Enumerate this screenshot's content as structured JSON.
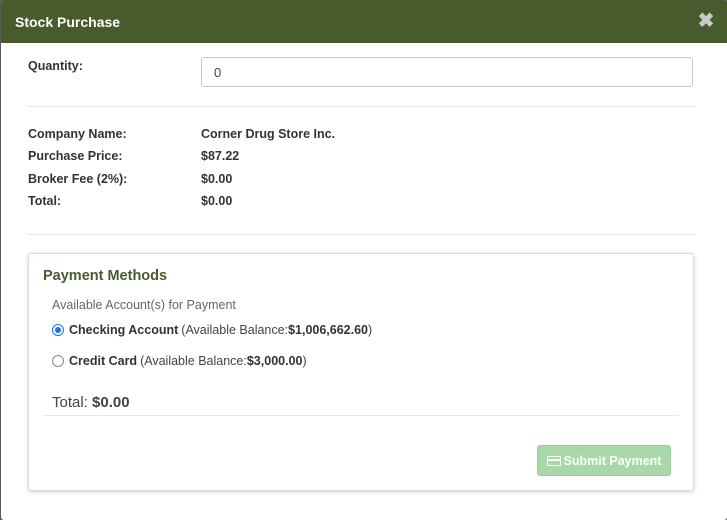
{
  "modal": {
    "title": "Stock Purchase",
    "close_icon": "close-icon"
  },
  "quantity": {
    "label": "Quantity:",
    "value": "0"
  },
  "details": [
    {
      "label": "Company Name:",
      "value": "Corner Drug Store Inc."
    },
    {
      "label": "Purchase Price:",
      "value": "$87.22"
    },
    {
      "label": "Broker Fee (2%):",
      "value": "$0.00"
    },
    {
      "label": "Total:",
      "value": "$0.00"
    }
  ],
  "payment": {
    "title": "Payment Methods",
    "available_label": "Available Account(s) for Payment",
    "accounts": [
      {
        "name": "Checking Account",
        "balance_prefix": "(Available Balance: ",
        "balance": "$1,006,662.60",
        "suffix": ")",
        "selected": true
      },
      {
        "name": "Credit Card",
        "balance_prefix": "(Available Balance: ",
        "balance": "$3,000.00",
        "suffix": ")",
        "selected": false
      }
    ],
    "total_label": "Total: ",
    "total_value": "$0.00",
    "submit_label": "Submit Payment",
    "submit_icon": "credit-card-icon"
  },
  "colors": {
    "header": "#475b2d",
    "accent_title": "#475b2d",
    "submit_bg": "#a8d8a8"
  }
}
